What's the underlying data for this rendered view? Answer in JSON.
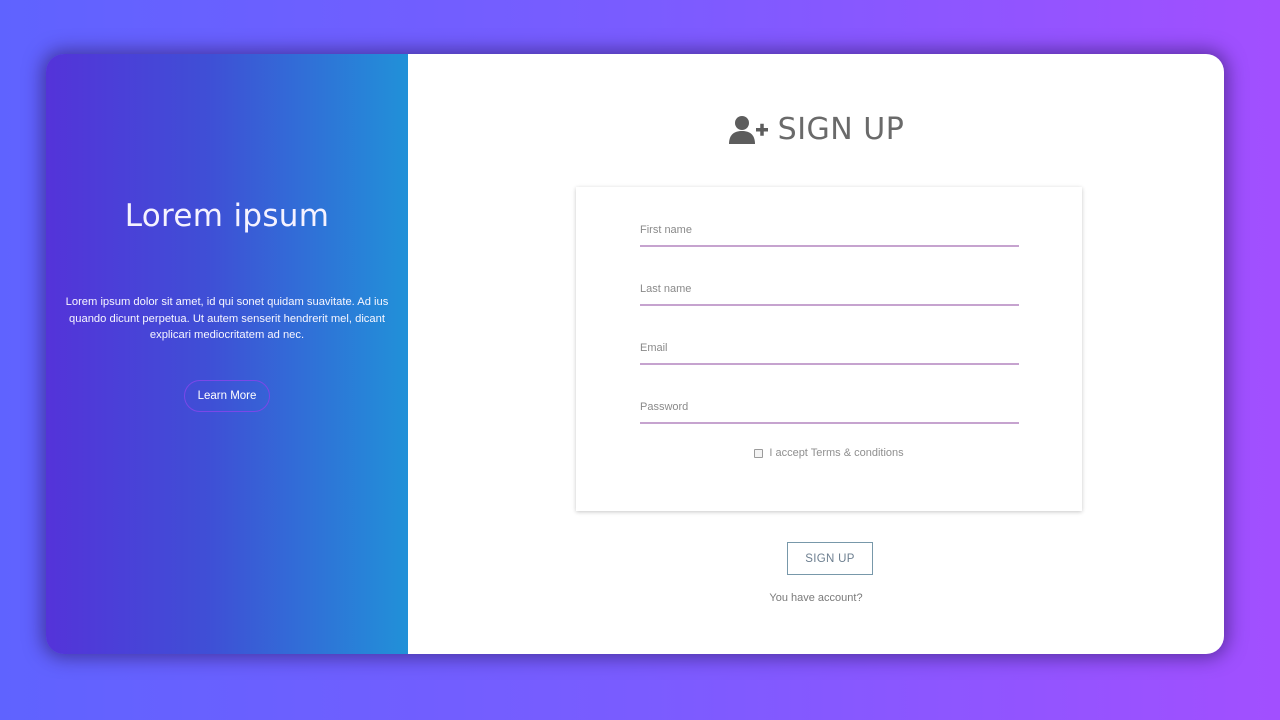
{
  "left_panel": {
    "heading": "Lorem ipsum",
    "body": "Lorem ipsum dolor sit amet, id qui sonet quidam suavitate. Ad ius quando dicunt perpetua. Ut autem senserit hendrerit mel, dicant explicari mediocritatem ad nec.",
    "button_label": "Learn More"
  },
  "form": {
    "title_icon": "user-plus-icon",
    "title": "SIGN UP",
    "fields": {
      "first_name": {
        "placeholder": "First name",
        "value": ""
      },
      "last_name": {
        "placeholder": "Last name",
        "value": ""
      },
      "email": {
        "placeholder": "Email",
        "value": ""
      },
      "password": {
        "placeholder": "Password",
        "value": ""
      }
    },
    "terms_label": "I accept Terms & conditions",
    "terms_checked": false,
    "submit_label": "SIGN UP",
    "account_link": "You have account?"
  },
  "colors": {
    "background_start": "#5f63ff",
    "background_end": "#a24fff",
    "panel_gradient_start": "#5433d9",
    "panel_gradient_end": "#2191d8",
    "field_underline": "#c6a3cf"
  }
}
